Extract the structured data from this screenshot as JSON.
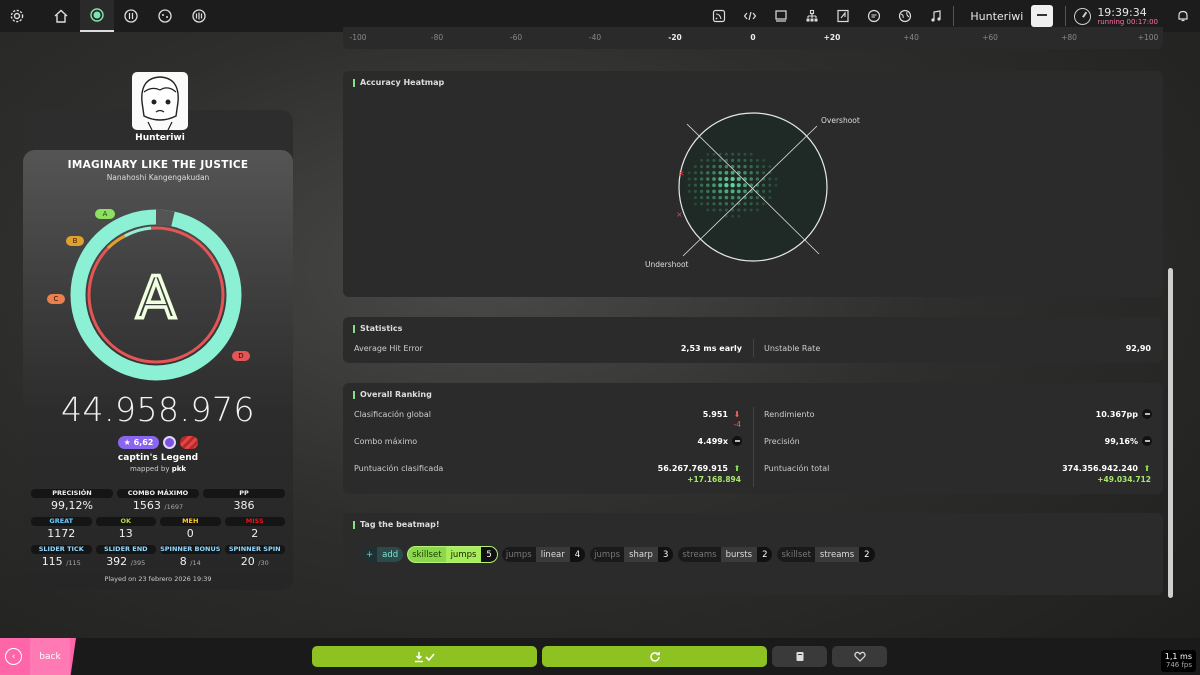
{
  "topbar": {
    "left_icons": [
      "settings-icon",
      "home-icon",
      "osu-mode-icon",
      "taiko-mode-icon",
      "catch-mode-icon",
      "mania-mode-icon"
    ],
    "right_icons": [
      "news-icon",
      "code-icon",
      "monitor-icon",
      "tree-icon",
      "beatmap-icon",
      "chat-icon",
      "globe-icon",
      "music-icon"
    ],
    "username": "Hunteriwi",
    "time": "19:39:34",
    "running": "running 00:17:00"
  },
  "axis": {
    "labels": [
      "-100",
      "-80",
      "-60",
      "-40",
      "-20",
      "0",
      "+20",
      "+40",
      "+60",
      "+80",
      "+100"
    ]
  },
  "heatmap": {
    "title": "Accuracy Heatmap",
    "overshoot": "Overshoot",
    "undershoot": "Undershoot",
    "colors": {
      "dot": "#5cdc9c",
      "ring": "#1f2a26"
    }
  },
  "statistics": {
    "title": "Statistics",
    "average_hit_error_label": "Average Hit Error",
    "average_hit_error_value": "2,53 ms early",
    "unstable_rate_label": "Unstable Rate",
    "unstable_rate_value": "92,90"
  },
  "ranking": {
    "title": "Overall Ranking",
    "global_rank_label": "Clasificación global",
    "global_rank_value": "5.951",
    "global_rank_change": "-4",
    "performance_label": "Rendimiento",
    "performance_value": "10.367pp",
    "max_combo_label": "Combo máximo",
    "max_combo_value": "4.499x",
    "accuracy_label": "Precisión",
    "accuracy_value": "99,16%",
    "ranked_score_label": "Puntuación clasificada",
    "ranked_score_value": "56.267.769.915",
    "ranked_score_change": "+17.168.894",
    "total_score_label": "Puntuación total",
    "total_score_value": "374.356.942.240",
    "total_score_change": "+49.034.712"
  },
  "tagging": {
    "title": "Tag the beatmap!",
    "add_plus": "+",
    "add_label": "add",
    "tags": [
      {
        "group": "skillset",
        "name": "jumps",
        "count": "5",
        "selected": true
      },
      {
        "group": "jumps",
        "name": "linear",
        "count": "4",
        "selected": false
      },
      {
        "group": "jumps",
        "name": "sharp",
        "count": "3",
        "selected": false
      },
      {
        "group": "streams",
        "name": "bursts",
        "count": "2",
        "selected": false
      },
      {
        "group": "skillset",
        "name": "streams",
        "count": "2",
        "selected": false
      }
    ]
  },
  "player": {
    "name": "Hunteriwi"
  },
  "score_card": {
    "title": "IMAGINARY LIKE THE JUSTICE",
    "artist": "Nanahoshi Kangengakudan",
    "rank": "A",
    "rank_labels": [
      "A",
      "B",
      "C",
      "D"
    ],
    "score": "44.958.976",
    "star_rating": "★ 6,62",
    "difficulty": "captin's Legend",
    "mapped_by_prefix": "mapped by",
    "mapper": "pkk",
    "accuracy_fraction": 0.9912,
    "colors": {
      "accent": "#6ee9c8",
      "mint": "#8cf0d4",
      "fail": "#e45555",
      "gold": "#e0a030"
    },
    "stats_row1": [
      {
        "label": "PRECISIÓN",
        "value": "99,12%",
        "sub": ""
      },
      {
        "label": "COMBO MÁXIMO",
        "value": "1563",
        "sub": "/1697"
      },
      {
        "label": "PP",
        "value": "386",
        "sub": ""
      }
    ],
    "stats_row2": [
      {
        "label": "GREAT",
        "value": "1172",
        "color": "#66ccff"
      },
      {
        "label": "OK",
        "value": "13",
        "color": "#b3d944"
      },
      {
        "label": "MEH",
        "value": "0",
        "color": "#ffcc22"
      },
      {
        "label": "MISS",
        "value": "2",
        "color": "#ed1121"
      }
    ],
    "stats_row3": [
      {
        "label": "SLIDER TICK",
        "value": "115",
        "sub": "/115",
        "color": "#8fd9ff"
      },
      {
        "label": "SLIDER END",
        "value": "392",
        "sub": "/395",
        "color": "#8fd9ff"
      },
      {
        "label": "SPINNER BONUS",
        "value": "8",
        "sub": "/14",
        "color": "#8fd9ff"
      },
      {
        "label": "SPINNER SPIN",
        "value": "20",
        "sub": "/30",
        "color": "#8fd9ff"
      }
    ],
    "played_on": "Played on 23 febrero 2026 19:39"
  },
  "bottom": {
    "back_label": "back",
    "fps_ms": "1,1 ms",
    "fps": "746 fps"
  }
}
